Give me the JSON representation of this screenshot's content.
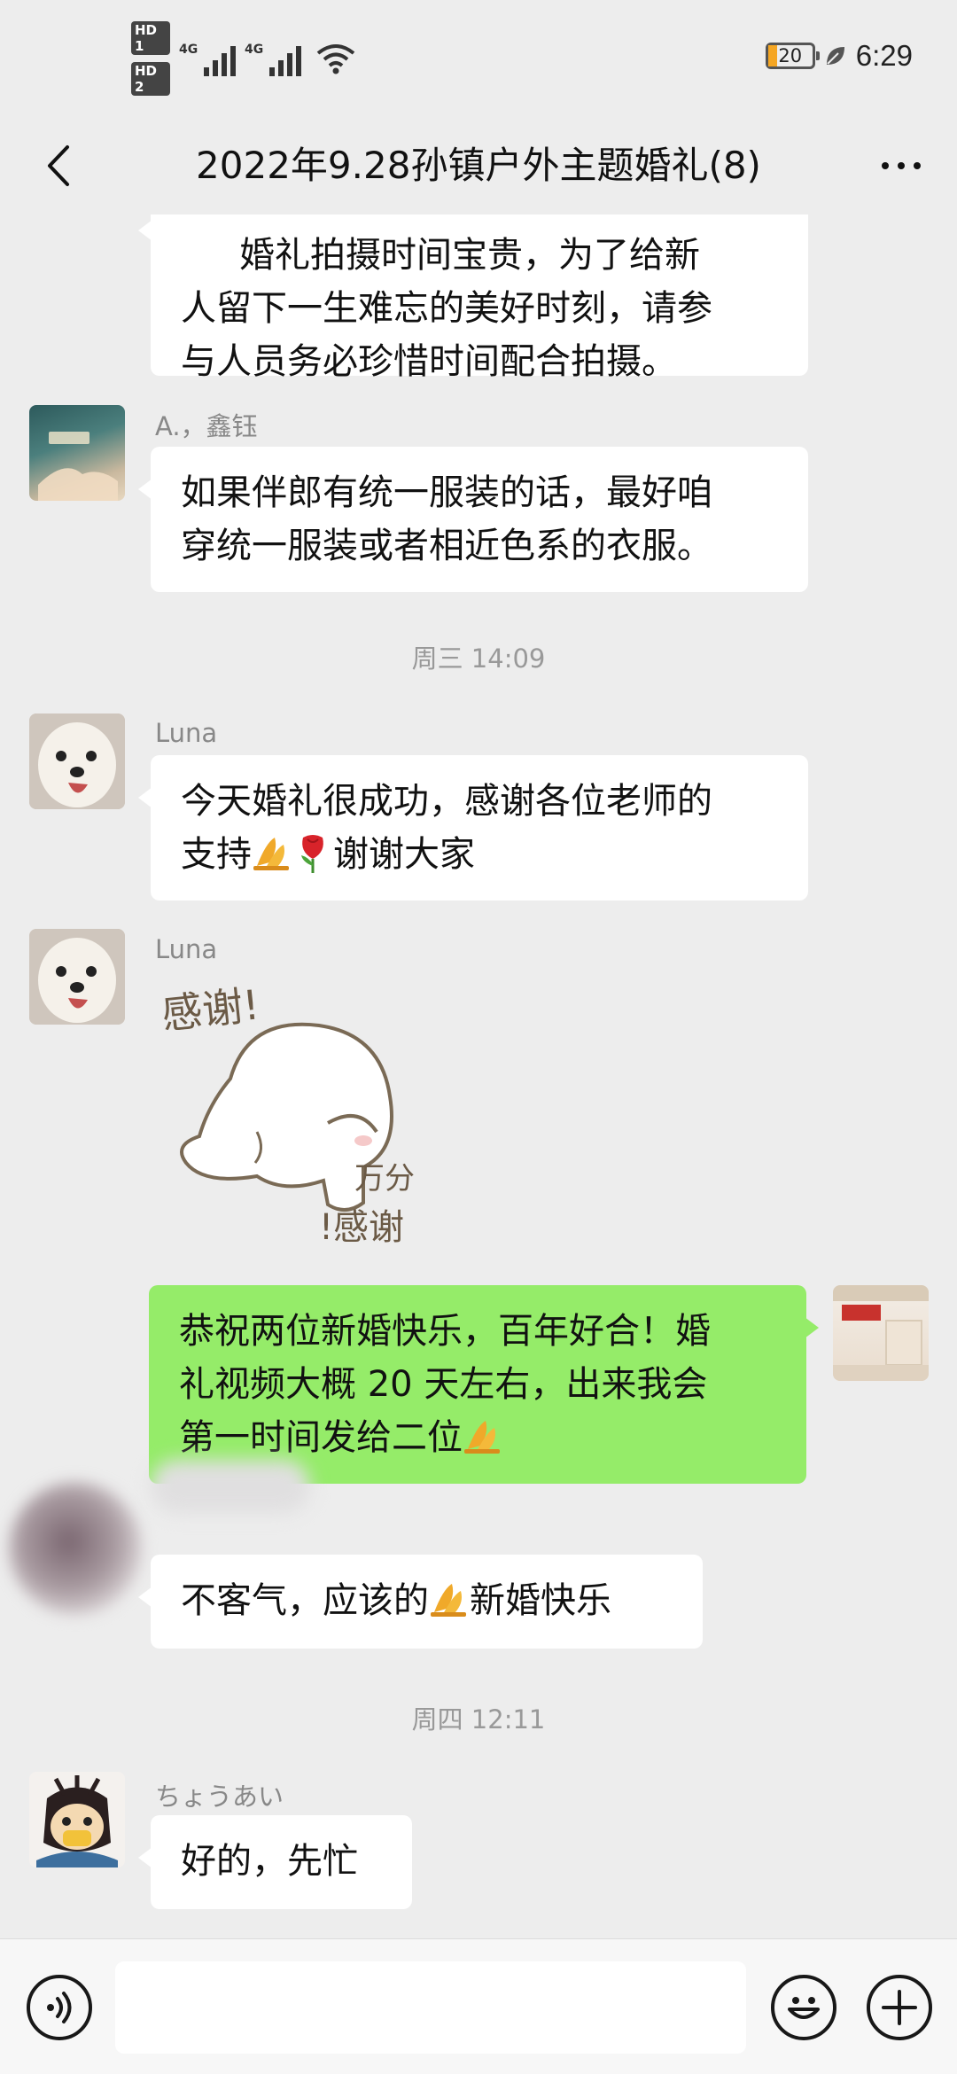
{
  "status_bar": {
    "hd1": "HD 1",
    "hd2": "HD 2",
    "net1": "4G",
    "net2": "4G",
    "battery": "20",
    "time": "6:29"
  },
  "header": {
    "title": "2022年9.28孙镇户外主题婚礼(8)",
    "back_icon": "chevron-left-icon",
    "more_icon": "more-dots-icon"
  },
  "messages": {
    "m1": {
      "lines": [
        "婚礼拍摄时间宝贵，为了给新",
        "人留下一生难忘的美好时刻，请参",
        "与人员务必珍惜时间配合拍摄。"
      ]
    },
    "m2": {
      "sender": "A.，鑫钰",
      "lines": [
        "如果伴郎有统一服装的话，最好咱",
        "穿统一服装或者相近色系的衣服。"
      ]
    },
    "ts1": "周三 14:09",
    "m3": {
      "sender": "Luna",
      "line1": "今天婚礼很成功，感谢各位老师的",
      "line2a": "支持",
      "line2b": "谢谢大家"
    },
    "m4": {
      "sender": "Luna",
      "sticker_text_top": "感谢!",
      "sticker_text_mid": "万分",
      "sticker_text_bottom": "!感谢"
    },
    "m5": {
      "line1": "恭祝两位新婚快乐，百年好合！婚",
      "line2": "礼视频大概 20 天左右，出来我会",
      "line3": "第一时间发给二位"
    },
    "m6": {
      "text_a": "不客气，应该的",
      "text_b": "新婚快乐"
    },
    "ts2": "周四 12:11",
    "m7": {
      "sender": "ちょうあい",
      "text": "好的，先忙"
    }
  },
  "input_bar": {
    "voice_icon": "voice-icon",
    "emoji_icon": "smile-icon",
    "plus_icon": "plus-icon"
  },
  "colors": {
    "background": "#ededed",
    "self_bubble": "#95ec69",
    "other_bubble": "#ffffff"
  }
}
